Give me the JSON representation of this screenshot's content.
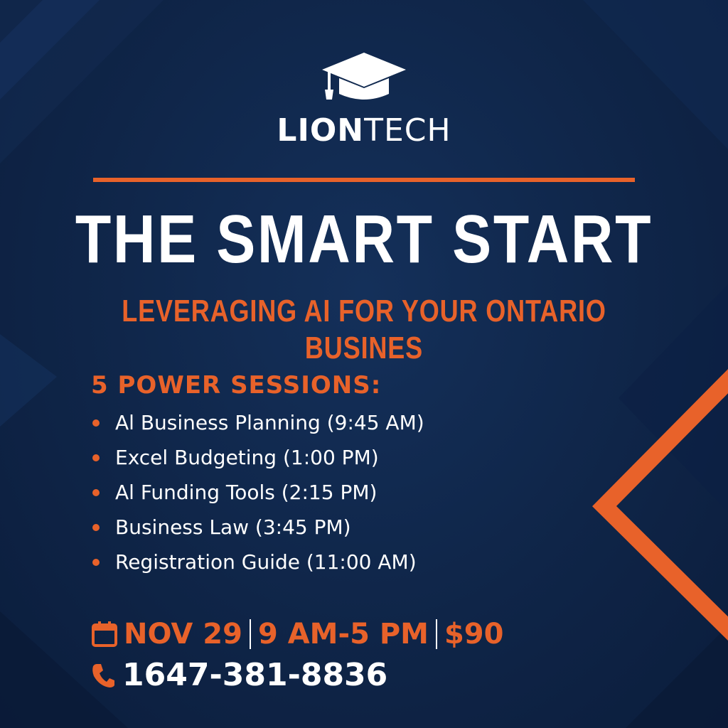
{
  "brand": {
    "name_bold": "LION",
    "name_light": "TECH",
    "logo_icon": "graduation-cap-icon"
  },
  "headline": {
    "title": "THE SMART START",
    "subtitle": "LEVERAGING AI FOR YOUR ONTARIO BUSINES"
  },
  "sessions": {
    "heading": "5 POWER SESSIONS:",
    "items": [
      "Al Business Planning (9:45 AM)",
      "Excel Budgeting (1:00 PM)",
      "Al Funding Tools (2:15 PM)",
      "Business Law (3:45 PM)",
      "Registration Guide (11:00 AM)"
    ]
  },
  "event": {
    "date": "NOV 29",
    "time": "9 AM-5 PM",
    "price": "$90",
    "date_icon": "calendar-icon"
  },
  "contact": {
    "phone": "1647-381-8836",
    "phone_icon": "phone-icon"
  },
  "colors": {
    "background": "#0f2548",
    "accent": "#e8622a",
    "text": "#ffffff"
  }
}
